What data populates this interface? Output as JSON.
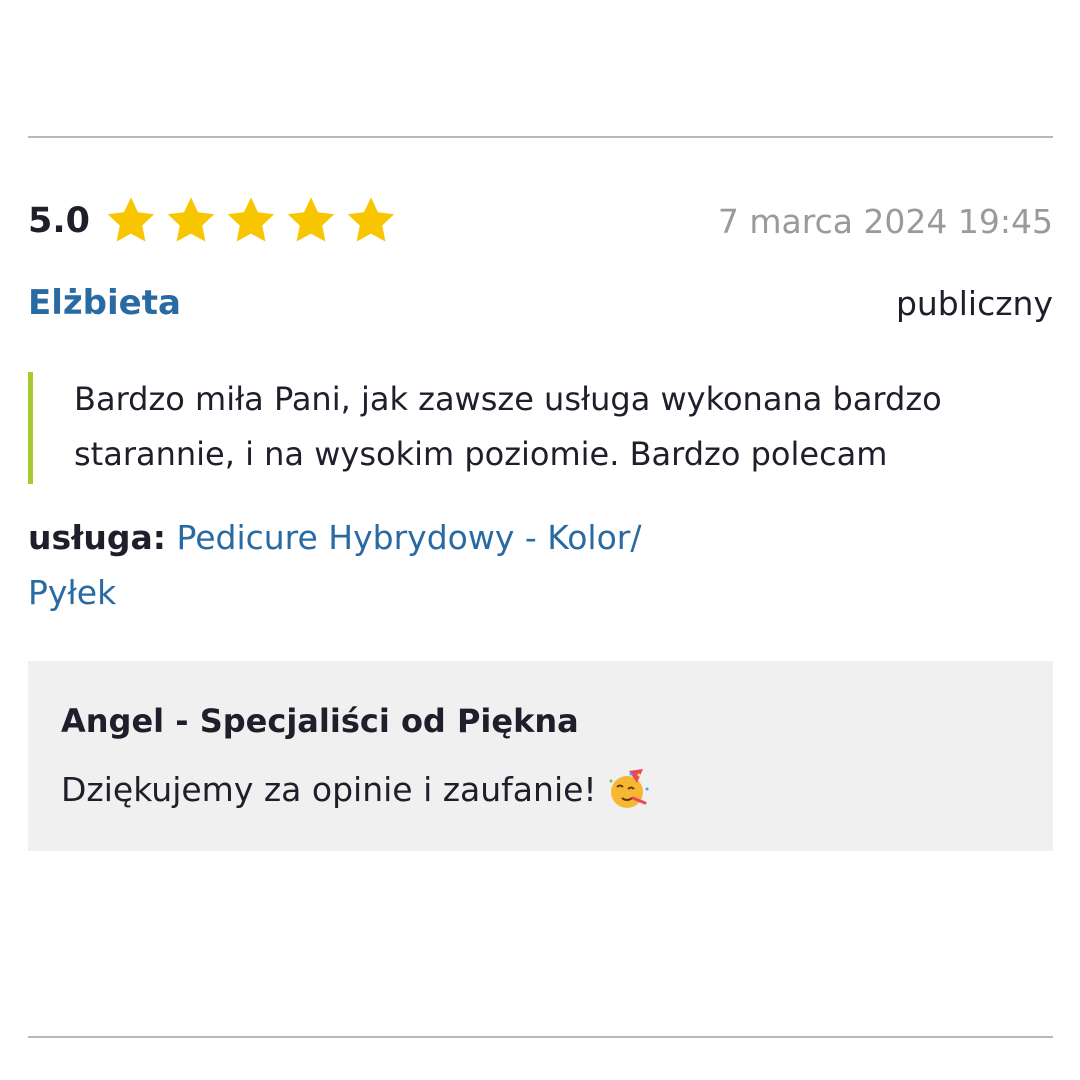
{
  "review": {
    "rating": "5.0",
    "stars": 5,
    "star_color": "#f7c600",
    "date": "7 marca 2024 19:45",
    "author": "Elżbieta",
    "visibility": "publiczny",
    "text": "Bardzo miła Pani, jak zawsze usługa wykonana bardzo starannie, i na wysokim poziomie. Bardzo polecam",
    "service_label": "usługa:",
    "service_name": "Pedicure Hybrydowy - Kolor/ Pyłek"
  },
  "reply": {
    "author": "Angel - Specjaliści od Piękna",
    "text": "Dziękujemy za opinie i zaufanie!",
    "icon": "partying-face-icon"
  },
  "colors": {
    "link": "#2a6aa3",
    "quote_bar": "#a8c92f",
    "reply_background": "#f0f0f0",
    "date": "#9a9a9a"
  }
}
